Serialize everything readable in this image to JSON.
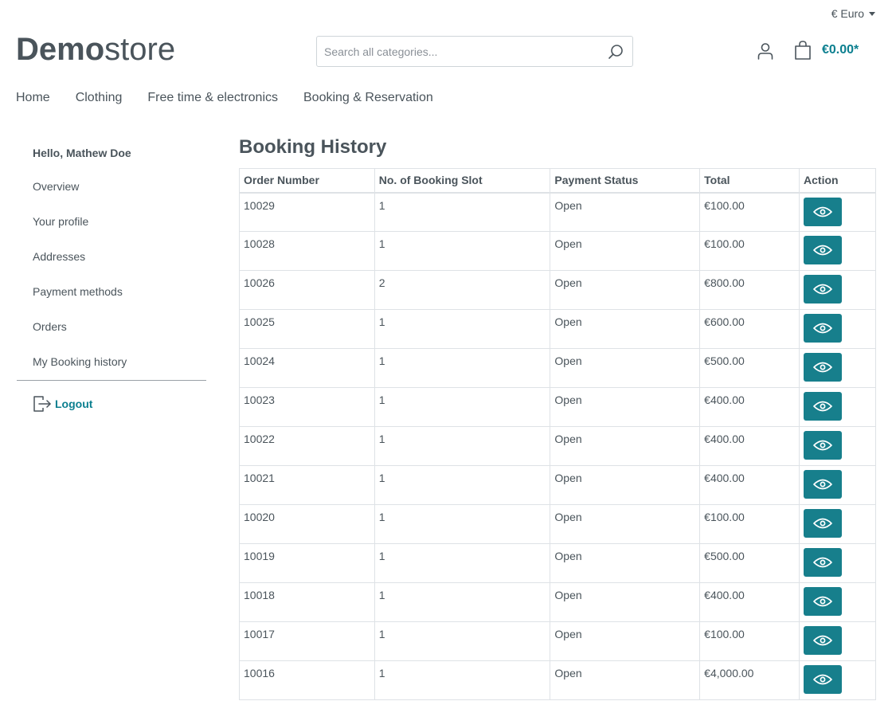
{
  "header": {
    "currency_label": "€ Euro",
    "logo_bold": "Demo",
    "logo_light": "store",
    "search_placeholder": "Search all categories...",
    "cart_total": "€0.00*"
  },
  "nav": [
    "Home",
    "Clothing",
    "Free time & electronics",
    "Booking & Reservation"
  ],
  "sidebar": {
    "greeting": "Hello, Mathew Doe",
    "items": [
      "Overview",
      "Your profile",
      "Addresses",
      "Payment methods",
      "Orders",
      "My Booking history"
    ],
    "logout_label": "Logout"
  },
  "booking": {
    "title": "Booking History",
    "columns": [
      "Order Number",
      "No. of Booking Slot",
      "Payment Status",
      "Total",
      "Action"
    ],
    "rows": [
      {
        "order": "10029",
        "slots": "1",
        "status": "Open",
        "total": "€100.00"
      },
      {
        "order": "10028",
        "slots": "1",
        "status": "Open",
        "total": "€100.00"
      },
      {
        "order": "10026",
        "slots": "2",
        "status": "Open",
        "total": "€800.00"
      },
      {
        "order": "10025",
        "slots": "1",
        "status": "Open",
        "total": "€600.00"
      },
      {
        "order": "10024",
        "slots": "1",
        "status": "Open",
        "total": "€500.00"
      },
      {
        "order": "10023",
        "slots": "1",
        "status": "Open",
        "total": "€400.00"
      },
      {
        "order": "10022",
        "slots": "1",
        "status": "Open",
        "total": "€400.00"
      },
      {
        "order": "10021",
        "slots": "1",
        "status": "Open",
        "total": "€400.00"
      },
      {
        "order": "10020",
        "slots": "1",
        "status": "Open",
        "total": "€100.00"
      },
      {
        "order": "10019",
        "slots": "1",
        "status": "Open",
        "total": "€500.00"
      },
      {
        "order": "10018",
        "slots": "1",
        "status": "Open",
        "total": "€400.00"
      },
      {
        "order": "10017",
        "slots": "1",
        "status": "Open",
        "total": "€100.00"
      },
      {
        "order": "10016",
        "slots": "1",
        "status": "Open",
        "total": "€4,000.00"
      }
    ],
    "action_icon": "eye-icon"
  },
  "colors": {
    "accent": "#177f8c",
    "text": "#4a545b",
    "border": "#dee2e6"
  }
}
